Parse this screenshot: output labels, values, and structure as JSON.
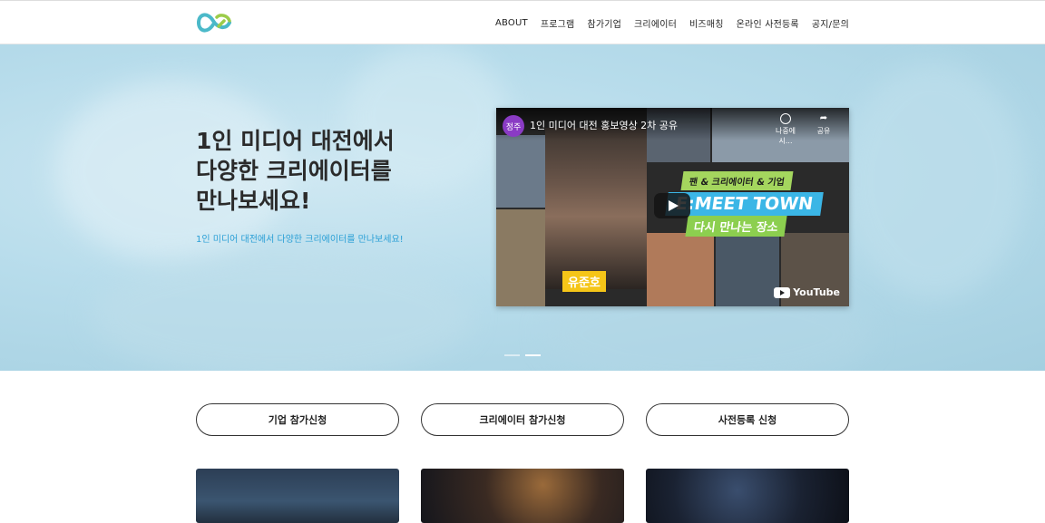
{
  "nav": {
    "items": [
      {
        "label": "ABOUT"
      },
      {
        "label": "프로그램"
      },
      {
        "label": "참가기업"
      },
      {
        "label": "크리에이터"
      },
      {
        "label": "비즈매칭"
      },
      {
        "label": "온라인 사전등록"
      },
      {
        "label": "공지/문의"
      }
    ]
  },
  "hero": {
    "title_lines": [
      "1인 미디어 대전에서",
      "다양한 크리에이터를",
      "만나보세요!"
    ],
    "subtitle": "1인 미디어 대전에서 다양한 크리에이터를 만나보세요!",
    "slide_count": 2,
    "active_slide": 2
  },
  "video": {
    "avatar_text": "정주",
    "title": "1인 미디어 대전 홍보영상 2차 공유",
    "watch_later_label": "나중에 시...",
    "share_label": "공유",
    "tag_fan": "팬 & 크리에이터 & 기업",
    "tag_meet": "E:MEET TOWN",
    "tag_place": "다시 만나는 장소",
    "name_caption": "유준호",
    "youtube_label": "YouTube"
  },
  "buttons": {
    "company": "기업 참가신청",
    "creator": "크리에이터 참가신청",
    "preregister": "사전등록 신청"
  },
  "colors": {
    "accent_blue": "#2a9fd6",
    "logo_teal": "#4bb9c9",
    "logo_green": "#9ccc4a"
  }
}
